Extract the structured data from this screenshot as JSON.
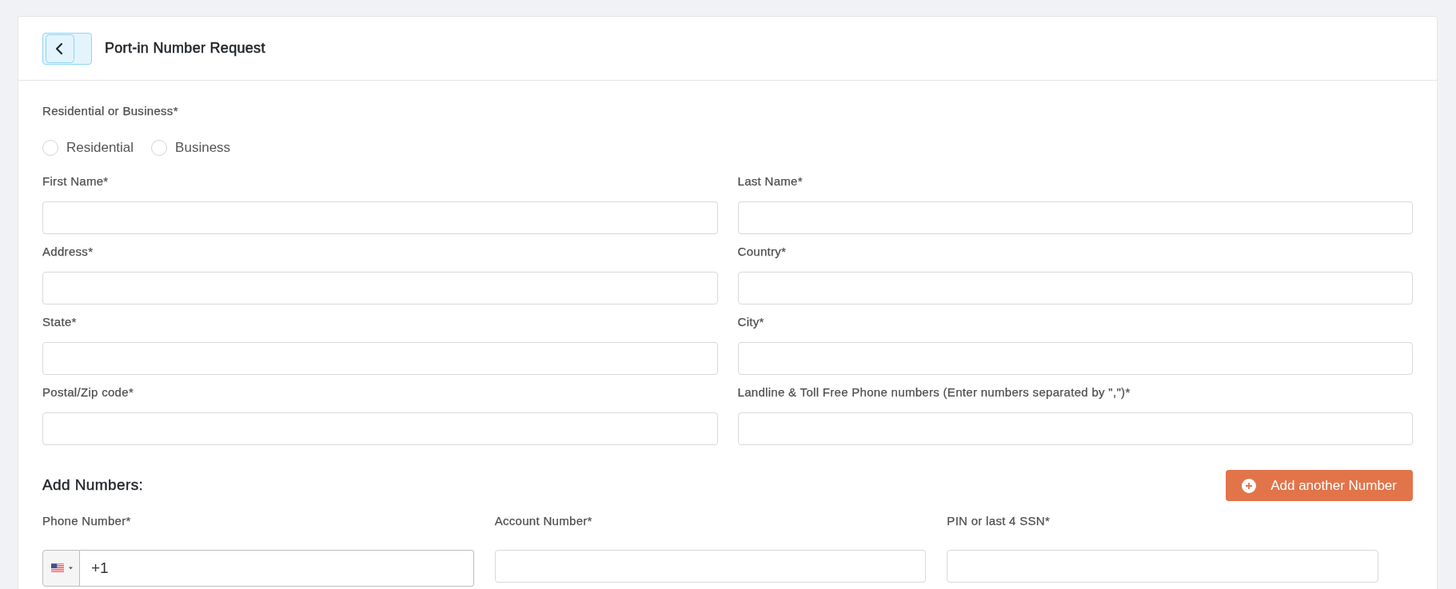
{
  "header": {
    "title": "Port-in Number Request"
  },
  "customer_type": {
    "label": "Residential or Business*",
    "options": [
      {
        "label": "Residential",
        "selected": false
      },
      {
        "label": "Business",
        "selected": false
      }
    ]
  },
  "fields": [
    {
      "label": "First Name*"
    },
    {
      "label": "Last Name*"
    },
    {
      "label": "Address*"
    },
    {
      "label": "Country*"
    },
    {
      "label": "State*"
    },
    {
      "label": "City*"
    },
    {
      "label": "Postal/Zip code*"
    },
    {
      "label": "Landline & Toll Free Phone numbers (Enter numbers separated by \",\")*"
    }
  ],
  "add_numbers": {
    "heading": "Add Numbers:",
    "button": "Add another Number",
    "fields": [
      {
        "kind": "phone",
        "label": "Phone Number*",
        "value": "+1"
      },
      {
        "kind": "text",
        "label": "Account Number*"
      },
      {
        "kind": "text",
        "label": "PIN or last 4 SSN*"
      }
    ]
  }
}
